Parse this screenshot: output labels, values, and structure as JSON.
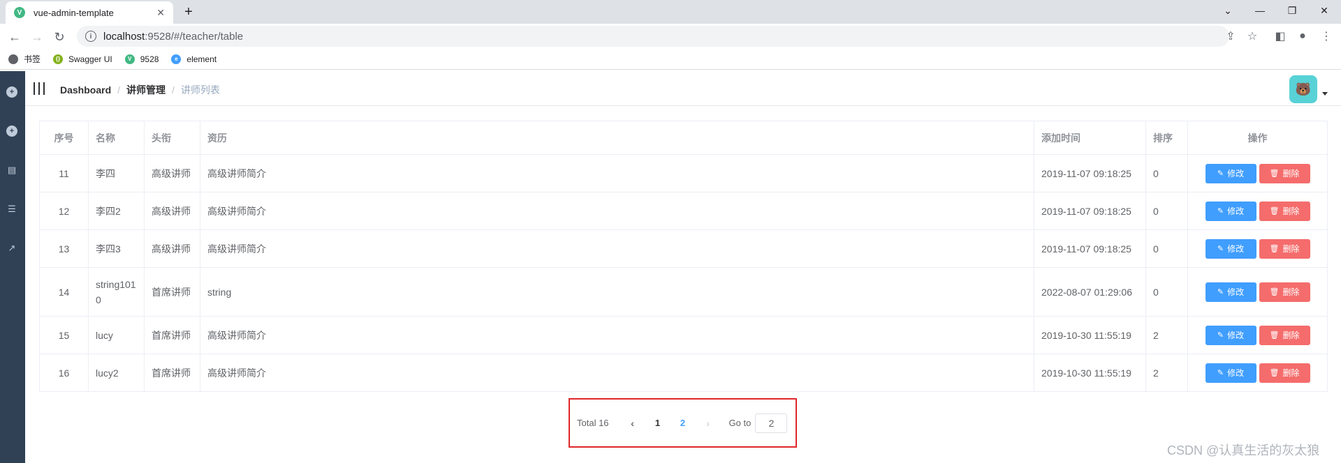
{
  "browser": {
    "tab_title": "vue-admin-template",
    "url_host": "localhost",
    "url_path": ":9528/#/teacher/table",
    "bookmarks": [
      {
        "label": "书签",
        "color": "#5f6368"
      },
      {
        "label": "Swagger UI",
        "color": "#85b21e"
      },
      {
        "label": "9528",
        "color": "#41b883"
      },
      {
        "label": "element",
        "color": "#409eff"
      }
    ]
  },
  "breadcrumb": {
    "home": "Dashboard",
    "section": "讲师管理",
    "current": "讲师列表",
    "separator": "/"
  },
  "table": {
    "headers": [
      "序号",
      "名称",
      "头衔",
      "资历",
      "添加时间",
      "排序",
      "操作"
    ],
    "edit_label": "修改",
    "delete_label": "删除",
    "rows": [
      {
        "idx": "11",
        "name": "李四",
        "title": "高级讲师",
        "intro": "高级讲师简介",
        "time": "2019-11-07 09:18:25",
        "sort": "0"
      },
      {
        "idx": "12",
        "name": "李四2",
        "title": "高级讲师",
        "intro": "高级讲师简介",
        "time": "2019-11-07 09:18:25",
        "sort": "0"
      },
      {
        "idx": "13",
        "name": "李四3",
        "title": "高级讲师",
        "intro": "高级讲师简介",
        "time": "2019-11-07 09:18:25",
        "sort": "0"
      },
      {
        "idx": "14",
        "name": "string1010",
        "title": "首席讲师",
        "intro": "string",
        "time": "2022-08-07 01:29:06",
        "sort": "0"
      },
      {
        "idx": "15",
        "name": "lucy",
        "title": "首席讲师",
        "intro": "高级讲师简介",
        "time": "2019-10-30 11:55:19",
        "sort": "2"
      },
      {
        "idx": "16",
        "name": "lucy2",
        "title": "首席讲师",
        "intro": "高级讲师简介",
        "time": "2019-10-30 11:55:19",
        "sort": "2"
      }
    ]
  },
  "pagination": {
    "total_label": "Total 16",
    "pages": [
      "1",
      "2"
    ],
    "current_page": "2",
    "goto_label": "Go to",
    "goto_value": "2"
  },
  "watermark": "CSDN @认真生活的灰太狼",
  "colors": {
    "sidebar": "#304156",
    "primary": "#409eff",
    "danger": "#f56c6c",
    "highlight_box": "#e0262a"
  }
}
